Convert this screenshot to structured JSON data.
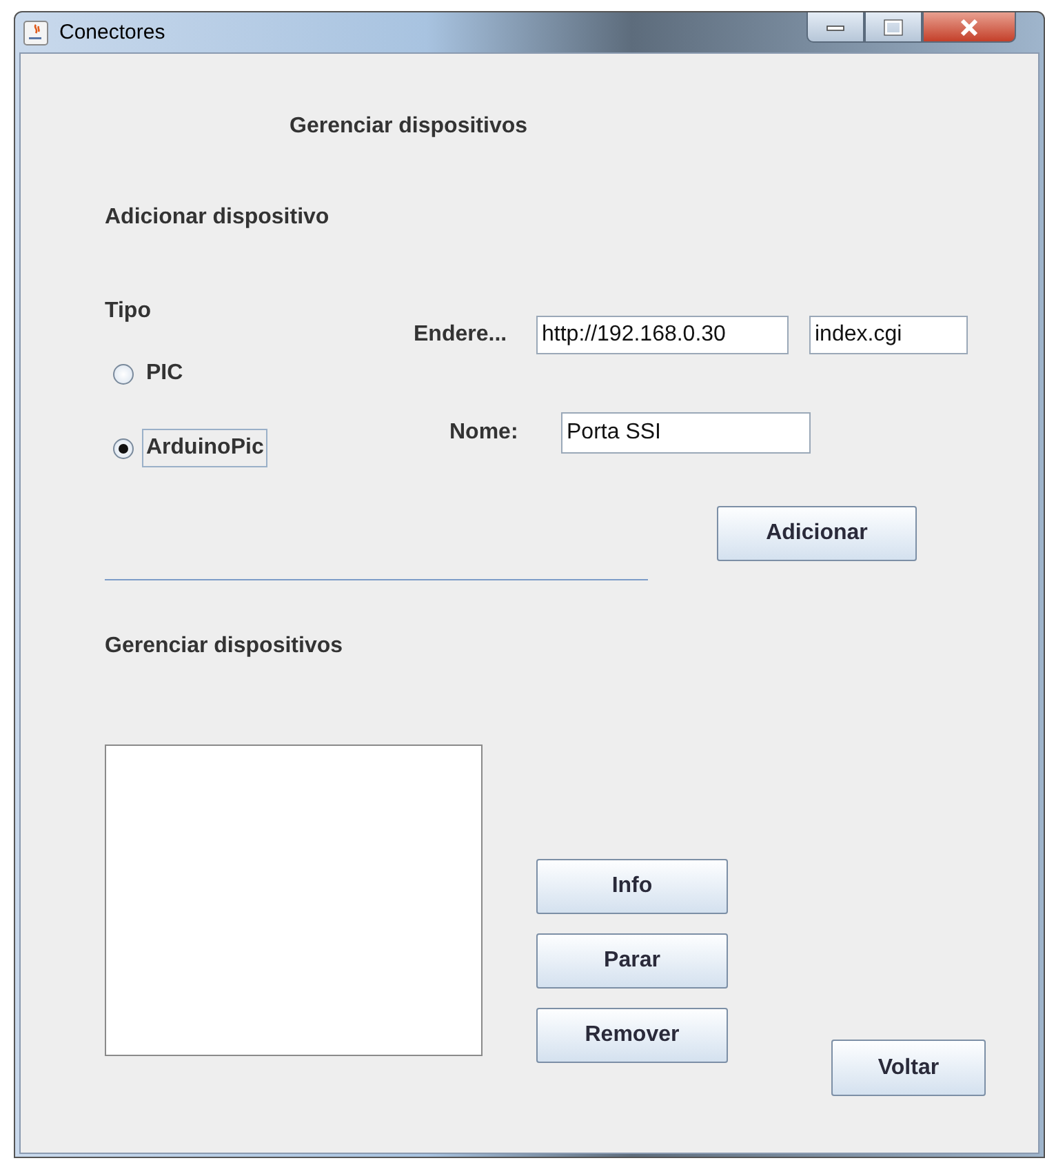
{
  "window": {
    "title": "Conectores"
  },
  "heading": "Gerenciar dispositivos",
  "add_section": {
    "title": "Adicionar dispositivo",
    "type_label": "Tipo",
    "types": [
      {
        "label": "PIC",
        "selected": false
      },
      {
        "label": "ArduinoPic",
        "selected": true
      }
    ],
    "address_label": "Endere...",
    "address_value": "http://192.168.0.30",
    "page_value": "index.cgi",
    "name_label": "Nome:",
    "name_value": "Porta SSI",
    "add_button": "Adicionar"
  },
  "manage_section": {
    "title": "Gerenciar dispositivos",
    "buttons": [
      "Info",
      "Parar",
      "Remover"
    ]
  },
  "back_button": "Voltar"
}
